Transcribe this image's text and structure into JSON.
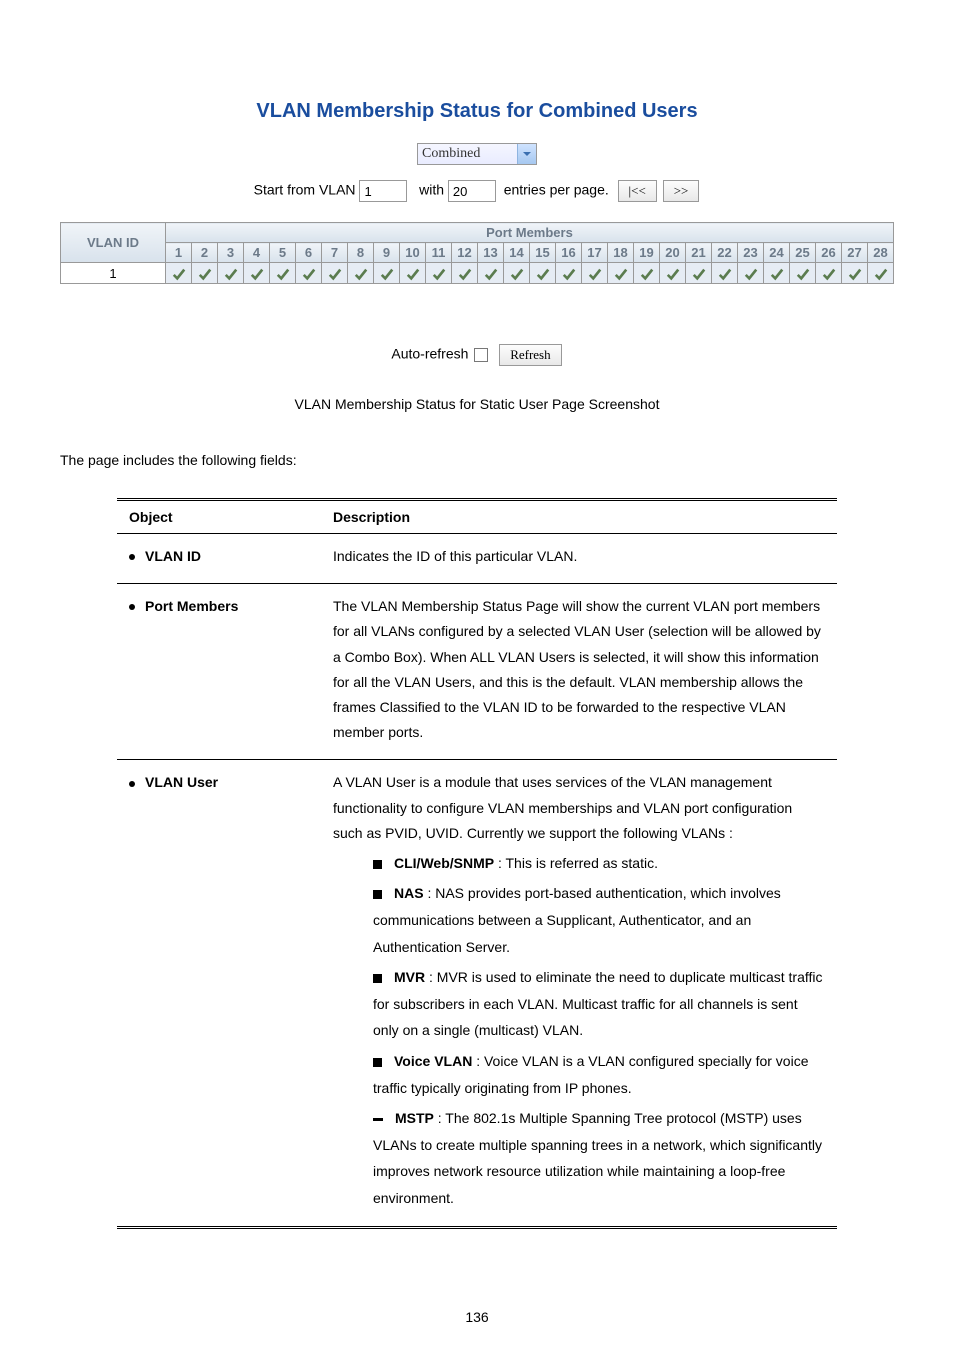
{
  "page_title": "VLAN Membership Status for Combined Users",
  "dropdown_value": "Combined",
  "filter": {
    "start_label_pre": "Start from VLAN",
    "start_value": "1",
    "with_label": "with",
    "with_value": "20",
    "entries_label": "entries per page.",
    "btn_first": "|<<",
    "btn_next": ">>"
  },
  "table_headers": {
    "port_members": "Port Members",
    "vlan_id": "VLAN ID",
    "ports": [
      "1",
      "2",
      "3",
      "4",
      "5",
      "6",
      "7",
      "8",
      "9",
      "10",
      "11",
      "12",
      "13",
      "14",
      "15",
      "16",
      "17",
      "18",
      "19",
      "20",
      "21",
      "22",
      "23",
      "24",
      "25",
      "26",
      "27",
      "28"
    ]
  },
  "table_rows": [
    {
      "vlan_id": "1",
      "members": [
        true,
        true,
        true,
        true,
        true,
        true,
        true,
        true,
        true,
        true,
        true,
        true,
        true,
        true,
        true,
        true,
        true,
        true,
        true,
        true,
        true,
        true,
        true,
        true,
        true,
        true,
        true,
        true
      ]
    }
  ],
  "refresh": {
    "auto_label": "Auto-refresh",
    "refresh_btn": "Refresh"
  },
  "caption": "VLAN Membership Status for Static User Page Screenshot",
  "intro": "The page includes the following fields:",
  "fields_headers": {
    "object": "Object",
    "description": "Description"
  },
  "fields": [
    {
      "object_label": "VLAN ID",
      "desc_paragraphs": [
        "Indicates the ID of this particular VLAN."
      ],
      "sub_items": []
    },
    {
      "object_label": "Port Members",
      "desc_paragraphs": [
        "The VLAN Membership Status Page will show the current VLAN port members for all VLANs configured by a selected VLAN User (selection will be allowed by a Combo Box). When ALL VLAN Users is selected, it will show this information for all the VLAN Users, and this is the default. VLAN membership allows the frames Classified to the VLAN ID to be forwarded to the respective VLAN member ports."
      ],
      "sub_items": []
    },
    {
      "object_label": "VLAN User",
      "desc_paragraphs": [
        "A VLAN User is a module that uses services of the VLAN management functionality to configure VLAN memberships and VLAN port configuration such as PVID, UVID. Currently we support the following VLANs :"
      ],
      "sub_items": [
        {
          "marker": "sq",
          "label": "CLI/Web/SNMP",
          "text": " : This is referred as static."
        },
        {
          "marker": "sq",
          "label": "NAS",
          "text": " : NAS provides port-based authentication, which involves communications between a Supplicant, Authenticator, and an Authentication Server."
        },
        {
          "marker": "sq",
          "label": "MVR",
          "text": " : MVR is used to eliminate the need to duplicate multicast traffic for subscribers in each VLAN. Multicast traffic for all channels is sent only on a single (multicast) VLAN."
        },
        {
          "marker": "sq",
          "label": "Voice VLAN",
          "text": " : Voice VLAN is a VLAN configured specially for voice traffic typically originating from IP phones."
        },
        {
          "marker": "dash",
          "label": "MSTP",
          "text": " : The 802.1s Multiple Spanning Tree protocol (MSTP) uses VLANs to create multiple spanning trees in a network, which significantly improves network resource utilization while maintaining a loop-free environment."
        }
      ]
    }
  ],
  "page_number": "136"
}
